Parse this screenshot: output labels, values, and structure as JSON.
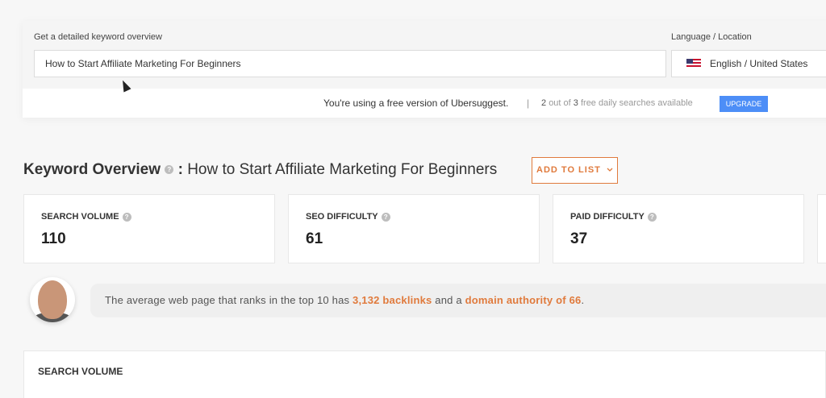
{
  "search": {
    "label": "Get a detailed keyword overview",
    "value": "How to Start Affiliate Marketing For Beginners",
    "lang_label": "Language / Location",
    "lang_value": "English / United States"
  },
  "notice": {
    "free_text": "You're using a free version of Ubersuggest.",
    "sep": "|",
    "used": "2",
    "out_of": "out of",
    "total": "3",
    "suffix": "free daily searches available",
    "upgrade": "UPGRADE"
  },
  "overview": {
    "title": "Keyword Overview",
    "colon": ":",
    "keyword": "How to Start Affiliate Marketing For Beginners",
    "add_to_list": "ADD TO LIST",
    "help_icon": "?"
  },
  "metrics": [
    {
      "label": "SEARCH VOLUME",
      "value": "110"
    },
    {
      "label": "SEO DIFFICULTY",
      "value": "61"
    },
    {
      "label": "PAID DIFFICULTY",
      "value": "37"
    }
  ],
  "tip": {
    "prefix": "The average web page that ranks in the top 10 has",
    "backlinks": "3,132 backlinks",
    "middle": "and a",
    "da": "domain authority of 66",
    "end": "."
  },
  "section": {
    "title": "SEARCH VOLUME"
  },
  "colors": {
    "accent": "#e07a3c",
    "upgrade": "#4d8ef7"
  }
}
